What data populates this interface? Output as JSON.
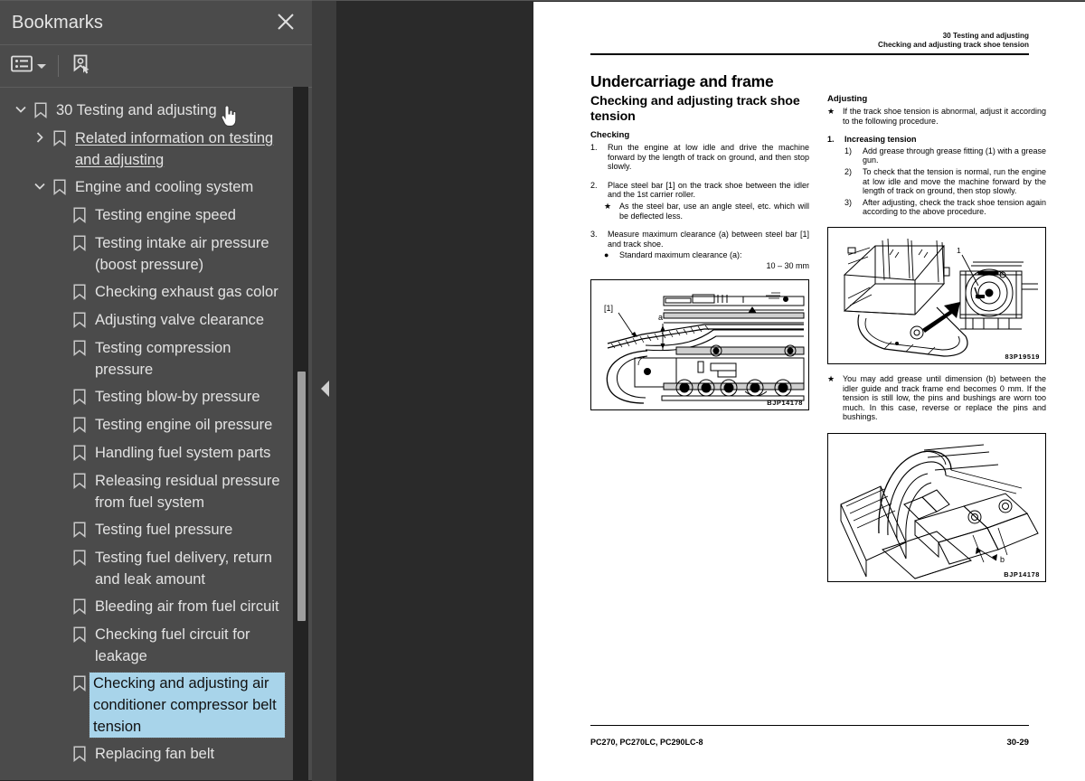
{
  "sidebar": {
    "title": "Bookmarks",
    "close_icon": "close-icon",
    "toolbar": {
      "options_label": "options-list-icon",
      "find_label": "bookmark-pointer-icon"
    },
    "items": [
      {
        "level": 0,
        "twisty": "down",
        "label": "30 Testing and adjusting",
        "selected": false,
        "link": false
      },
      {
        "level": 1,
        "twisty": "right",
        "label": "Related information on testing and adjusting",
        "selected": false,
        "link": true
      },
      {
        "level": 1,
        "twisty": "down",
        "label": "Engine and cooling system",
        "selected": false,
        "link": false
      },
      {
        "level": 2,
        "twisty": "none",
        "label": "Testing engine speed",
        "selected": false,
        "link": false
      },
      {
        "level": 2,
        "twisty": "none",
        "label": "Testing intake air pressure (boost pressure)",
        "selected": false,
        "link": false
      },
      {
        "level": 2,
        "twisty": "none",
        "label": "Checking exhaust gas color",
        "selected": false,
        "link": false
      },
      {
        "level": 2,
        "twisty": "none",
        "label": "Adjusting valve clearance",
        "selected": false,
        "link": false
      },
      {
        "level": 2,
        "twisty": "none",
        "label": "Testing compression pressure",
        "selected": false,
        "link": false
      },
      {
        "level": 2,
        "twisty": "none",
        "label": "Testing blow-by pressure",
        "selected": false,
        "link": false
      },
      {
        "level": 2,
        "twisty": "none",
        "label": "Testing engine oil pressure",
        "selected": false,
        "link": false
      },
      {
        "level": 2,
        "twisty": "none",
        "label": "Handling fuel system parts",
        "selected": false,
        "link": false
      },
      {
        "level": 2,
        "twisty": "none",
        "label": "Releasing residual pressure from fuel system",
        "selected": false,
        "link": false
      },
      {
        "level": 2,
        "twisty": "none",
        "label": "Testing fuel pressure",
        "selected": false,
        "link": false
      },
      {
        "level": 2,
        "twisty": "none",
        "label": "Testing fuel delivery, return and leak amount",
        "selected": false,
        "link": false
      },
      {
        "level": 2,
        "twisty": "none",
        "label": "Bleeding air from fuel circuit",
        "selected": false,
        "link": false
      },
      {
        "level": 2,
        "twisty": "none",
        "label": "Checking fuel circuit for leakage",
        "selected": false,
        "link": false
      },
      {
        "level": 2,
        "twisty": "none",
        "label": "Checking and adjusting air conditioner compressor belt tension",
        "selected": true,
        "link": false
      },
      {
        "level": 2,
        "twisty": "none",
        "label": "Replacing fan belt",
        "selected": false,
        "link": false
      }
    ]
  },
  "viewer": {
    "collapse_handle": "collapse-sidebar-handle"
  },
  "document": {
    "header_line1": "30 Testing and adjusting",
    "header_line2": "Checking and adjusting track shoe tension",
    "title": "Undercarriage and frame",
    "left": {
      "heading": "Checking and adjusting track shoe tension",
      "subheading": "Checking",
      "step1_num": "1.",
      "step1_text": "Run the engine at low idle and drive the machine forward by the length of track on ground, and then stop slowly.",
      "step2_num": "2.",
      "step2_text": "Place steel bar [1] on the track shoe between the idler and the 1st carrier roller.",
      "step2_note_mark": "★",
      "step2_note": "As the steel bar, use an angle steel, etc. which will be deflected less.",
      "step3_num": "3.",
      "step3_text": "Measure maximum clearance (a) between steel bar [1] and track shoe.",
      "step3_note_mark": "●",
      "step3_note": "Standard maximum clearance (a):",
      "step3_value": "10 – 30 mm",
      "figure_code": "BJP14178",
      "figure_label_bracket": "[1]",
      "figure_label_a": "a"
    },
    "right": {
      "subheading": "Adjusting",
      "note_mark": "★",
      "note_text": "If the track shoe tension is abnormal, adjust it according to the following procedure.",
      "step1_num": "1.",
      "step1_text": "Increasing tension",
      "sub1_num": "1)",
      "sub1_text": "Add grease through grease fitting (1) with a grease gun.",
      "sub2_num": "2)",
      "sub2_text": "To check that the tension is normal, run the engine at low idle and move the machine forward by the length of track on ground, then stop slowly.",
      "sub3_num": "3)",
      "sub3_text": "After adjusting, check the track shoe tension again according to the above procedure.",
      "figure1_code": "83P19519",
      "figure1_label": "1",
      "note2_mark": "★",
      "note2_text": "You may add grease until dimension (b) between the idler guide and track frame end becomes 0 mm. If the tension is still low, the pins and bushings are worn too much.  In this case, reverse or replace the pins and bushings.",
      "figure2_code": "BJP14178",
      "figure2_label_b": "b"
    },
    "footer_left": "PC270, PC270LC, PC290LC-8",
    "footer_right": "30-29"
  },
  "colors": {
    "sidebar_bg": "#4b4b4b",
    "viewer_bg": "#2a2a2a",
    "gutter_bg": "#3d3d3d",
    "selection": "#a8d4ea",
    "text": "#e3e3e3"
  }
}
